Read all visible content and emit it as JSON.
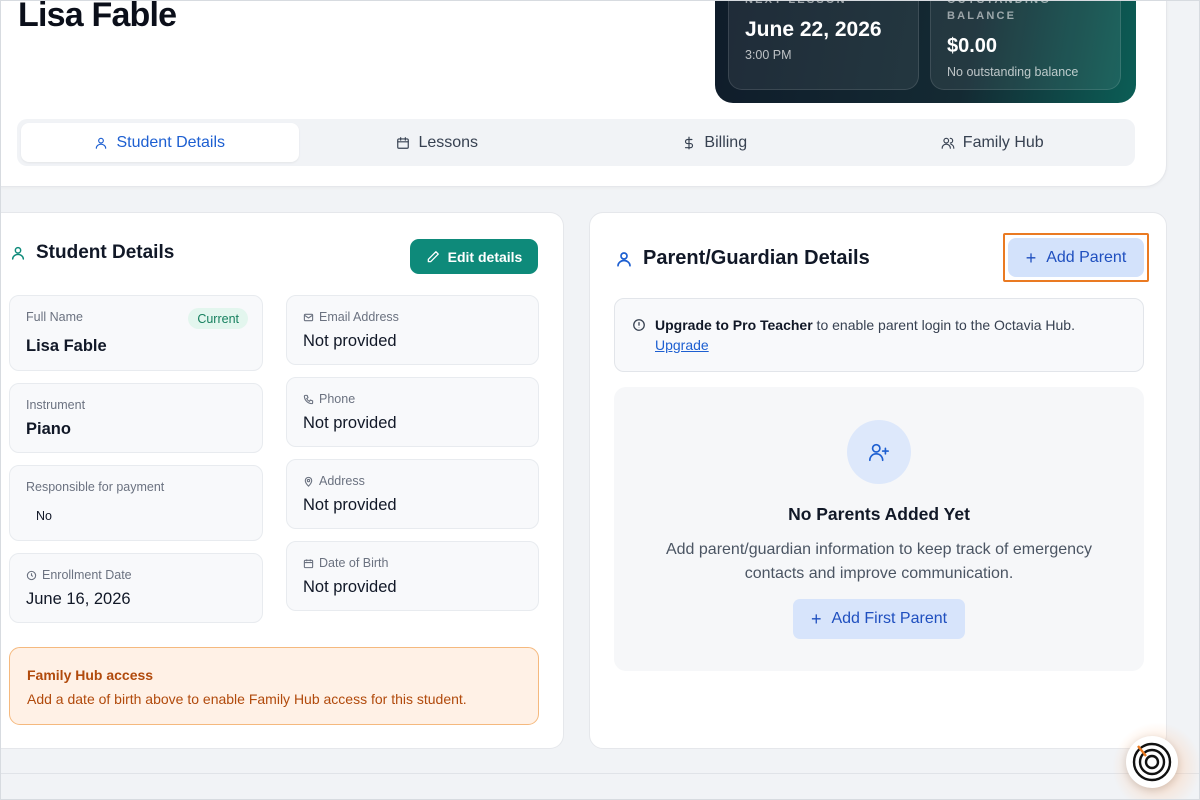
{
  "student": {
    "name": "Lisa Fable"
  },
  "stats": {
    "next_lesson": {
      "label": "NEXT LESSON",
      "date": "June 22, 2026",
      "time": "3:00 PM"
    },
    "balance": {
      "label": "OUTSTANDING BALANCE",
      "value": "$0.00",
      "note": "No outstanding balance"
    }
  },
  "tabs": [
    {
      "label": "Student Details",
      "icon": "user-icon",
      "active": true
    },
    {
      "label": "Lessons",
      "icon": "calendar-icon",
      "active": false
    },
    {
      "label": "Billing",
      "icon": "dollar-icon",
      "active": false
    },
    {
      "label": "Family Hub",
      "icon": "users-icon",
      "active": false
    }
  ],
  "student_details": {
    "title": "Student Details",
    "edit_label": "Edit details",
    "full_name": {
      "label": "Full Name",
      "value": "Lisa Fable",
      "badge": "Current"
    },
    "instrument": {
      "label": "Instrument",
      "value": "Piano"
    },
    "responsible": {
      "label": "Responsible for payment",
      "value": "No"
    },
    "enrollment": {
      "label": "Enrollment Date",
      "value": "June 16, 2026"
    },
    "email": {
      "label": "Email Address",
      "value": "Not provided"
    },
    "phone": {
      "label": "Phone",
      "value": "Not provided"
    },
    "address": {
      "label": "Address",
      "value": "Not provided"
    },
    "dob": {
      "label": "Date of Birth",
      "value": "Not provided"
    },
    "family_hub_alert": {
      "title": "Family Hub access",
      "text": "Add a date of birth above to enable Family Hub access for this student."
    }
  },
  "parent_details": {
    "title": "Parent/Guardian Details",
    "add_label": "Add Parent",
    "upgrade": {
      "bold": "Upgrade to Pro Teacher",
      "text": " to enable parent login to the Octavia Hub.",
      "link": "Upgrade"
    },
    "empty": {
      "title": "No Parents Added Yet",
      "desc": "Add parent/guardian information to keep track of emergency contacts and improve communication.",
      "button": "Add First Parent"
    }
  },
  "colors": {
    "accent_blue": "#1d5fd1",
    "teal_button": "#0e8a7a",
    "highlight_orange": "#ea7a22",
    "alert_text": "#b14a0c"
  }
}
